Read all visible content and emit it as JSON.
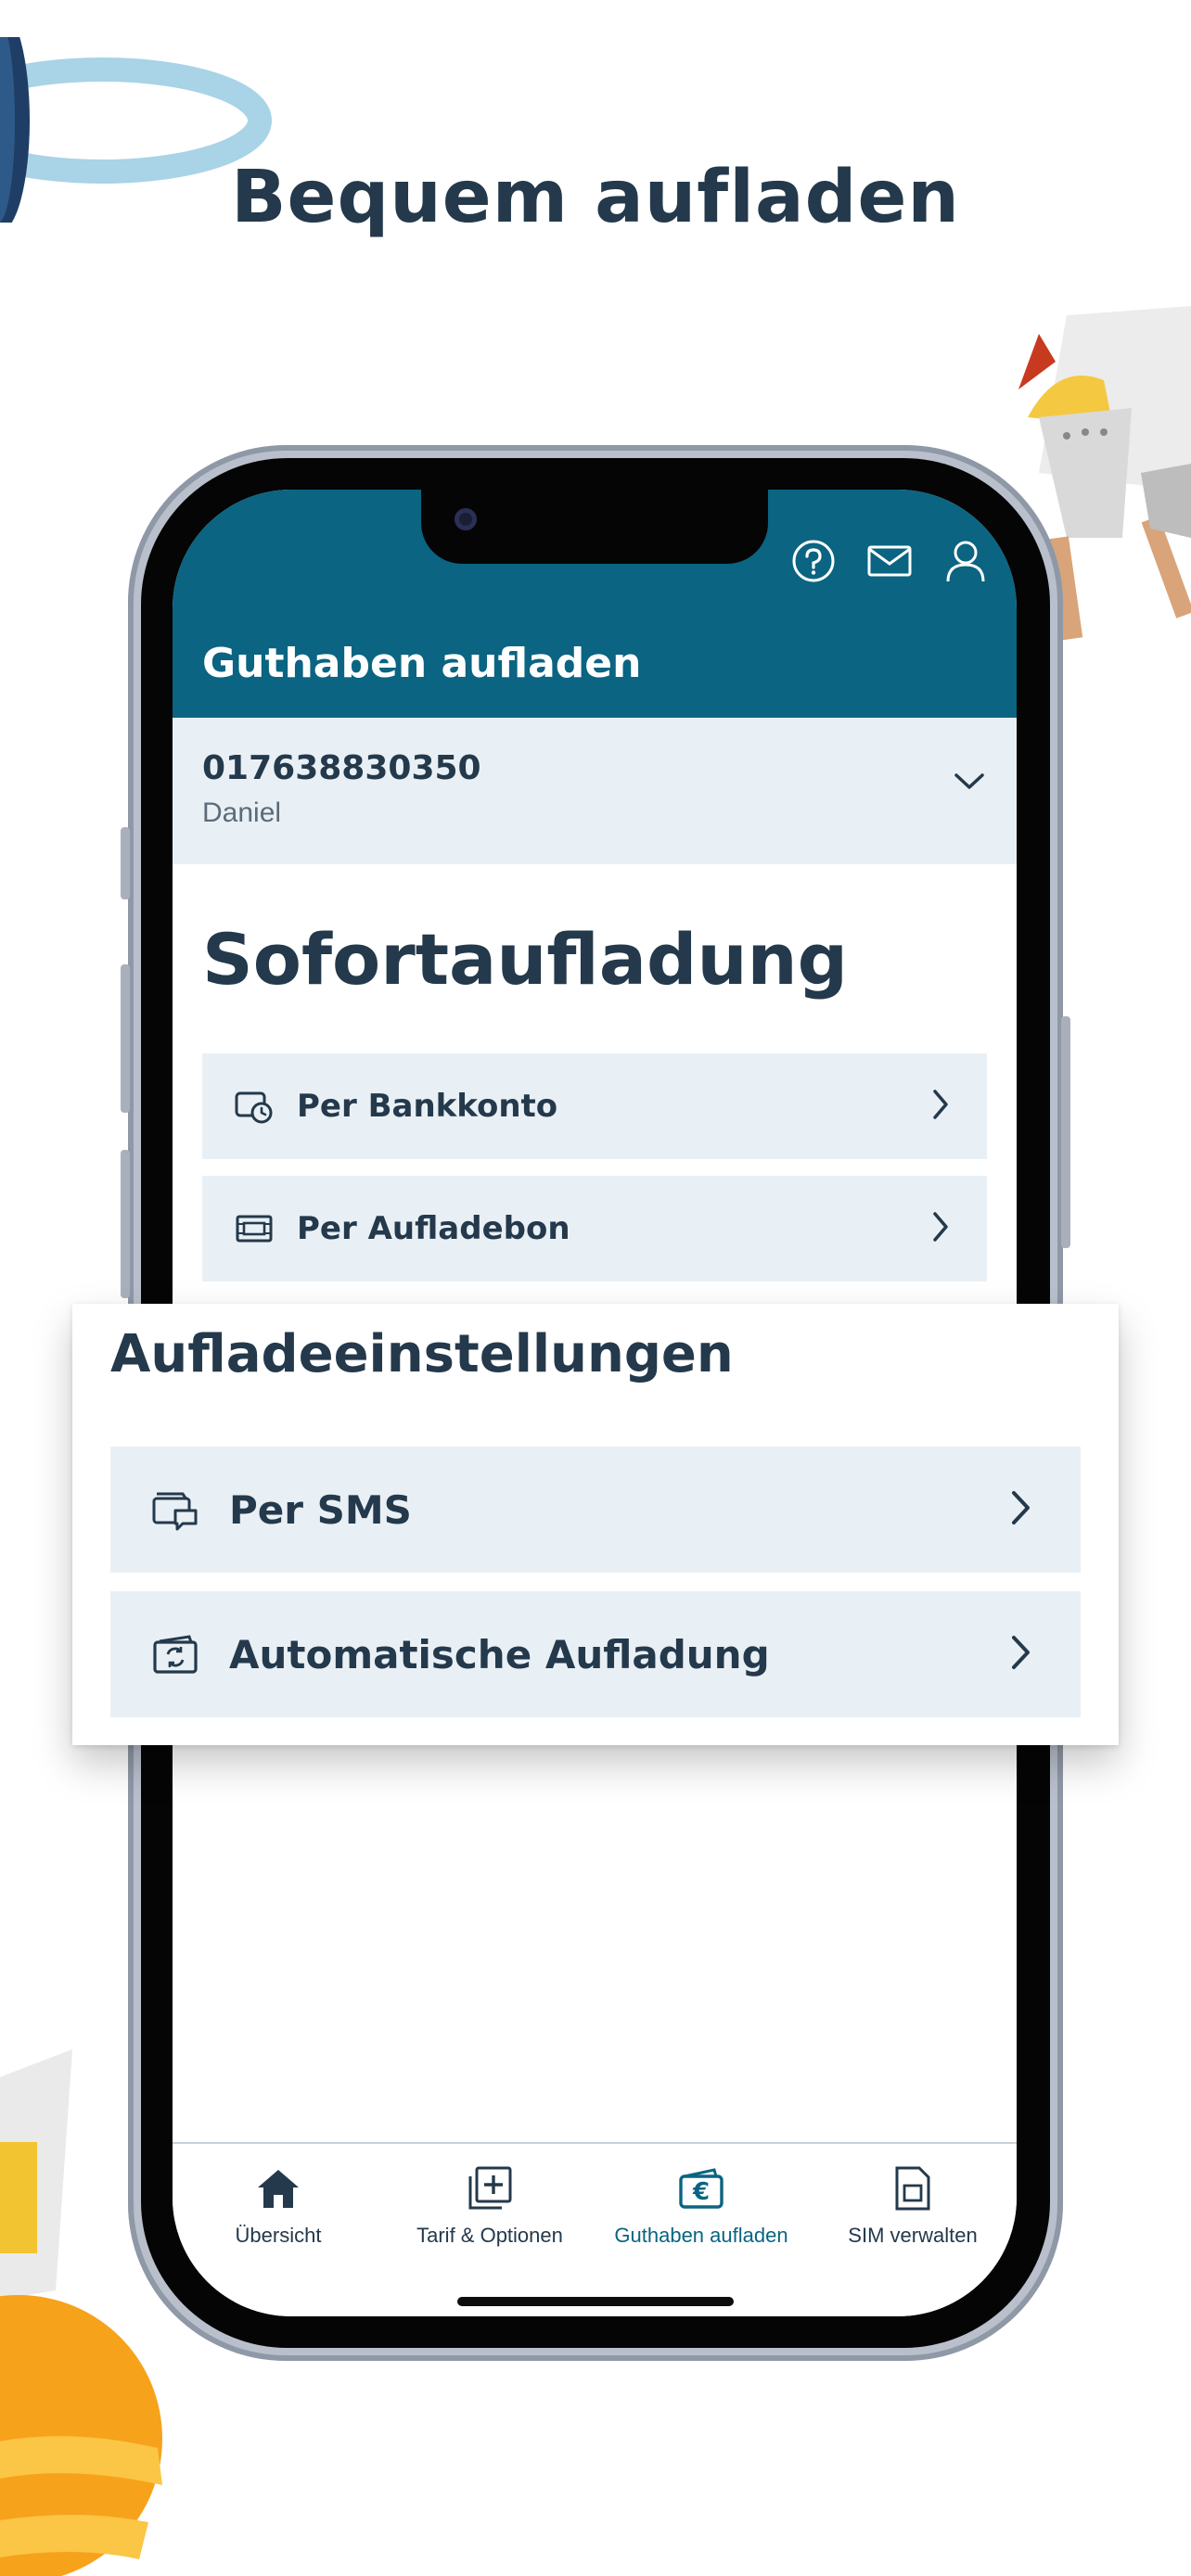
{
  "headline": "Bequem aufladen",
  "app": {
    "header_title": "Guthaben aufladen",
    "header_icons": [
      "help-icon",
      "mail-icon",
      "user-icon"
    ],
    "account": {
      "number": "017638830350",
      "name": "Daniel"
    },
    "section_title": "Sofortaufladung",
    "instant_options": [
      {
        "label": "Per Bankkonto",
        "icon": "bank-clock-icon"
      },
      {
        "label": "Per Aufladebon",
        "icon": "voucher-icon"
      }
    ],
    "bottom_nav": [
      {
        "label": "Übersicht",
        "icon": "home-icon",
        "active": false
      },
      {
        "label": "Tarif & Optionen",
        "icon": "add-square-icon",
        "active": false
      },
      {
        "label": "Guthaben aufladen",
        "icon": "wallet-euro-icon",
        "active": true
      },
      {
        "label": "SIM verwalten",
        "icon": "sim-card-icon",
        "active": false
      }
    ]
  },
  "settings_card": {
    "title": "Aufladeeinstellungen",
    "options": [
      {
        "label": "Per SMS",
        "icon": "sms-card-icon"
      },
      {
        "label": "Automatische Aufladung",
        "icon": "auto-topup-icon"
      }
    ]
  },
  "colors": {
    "brand": "#0a6482",
    "text": "#24394b",
    "row_bg": "#e9f0f5"
  }
}
